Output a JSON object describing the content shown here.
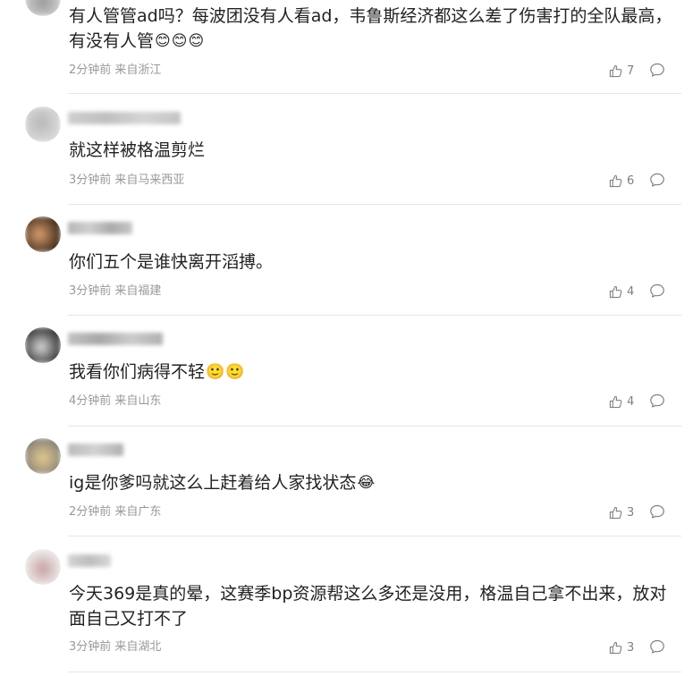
{
  "colors": {
    "text": "#222222",
    "meta": "#999999",
    "icon": "#808080",
    "divider": "#e6e6e6"
  },
  "comments": [
    {
      "text": "有人管管ad吗？每波团没有人看ad，韦鲁斯经济都这么差了伤害打的全队最高，有没有人管",
      "emojis": [
        "😊",
        "😊",
        "😊"
      ],
      "time": "2分钟前",
      "location": "来自浙江",
      "likes": "7",
      "icons": [
        "thumbs-up-icon",
        "reply-icon"
      ]
    },
    {
      "text": "就这样被格温剪烂",
      "time": "3分钟前",
      "location": "来自马来西亚",
      "likes": "6",
      "icons": [
        "thumbs-up-icon",
        "reply-icon"
      ]
    },
    {
      "text": "你们五个是谁快离开滔搏。",
      "time": "3分钟前",
      "location": "来自福建",
      "likes": "4",
      "icons": [
        "thumbs-up-icon",
        "reply-icon"
      ]
    },
    {
      "text": "我看你们病得不轻",
      "emojis": [
        "🙂",
        "🙂"
      ],
      "time": "4分钟前",
      "location": "来自山东",
      "likes": "4",
      "icons": [
        "thumbs-up-icon",
        "reply-icon"
      ]
    },
    {
      "text": "ig是你爹吗就这么上赶着给人家找状态",
      "emojis": [
        "😂"
      ],
      "time": "2分钟前",
      "location": "来自广东",
      "likes": "3",
      "icons": [
        "thumbs-up-icon",
        "reply-icon"
      ]
    },
    {
      "text": "今天369是真的晕，这赛季bp资源帮这么多还是没用，格温自己拿不出来，放对面自己又打不了",
      "time": "3分钟前",
      "location": "来自湖北",
      "likes": "3",
      "icons": [
        "thumbs-up-icon",
        "reply-icon"
      ]
    }
  ]
}
